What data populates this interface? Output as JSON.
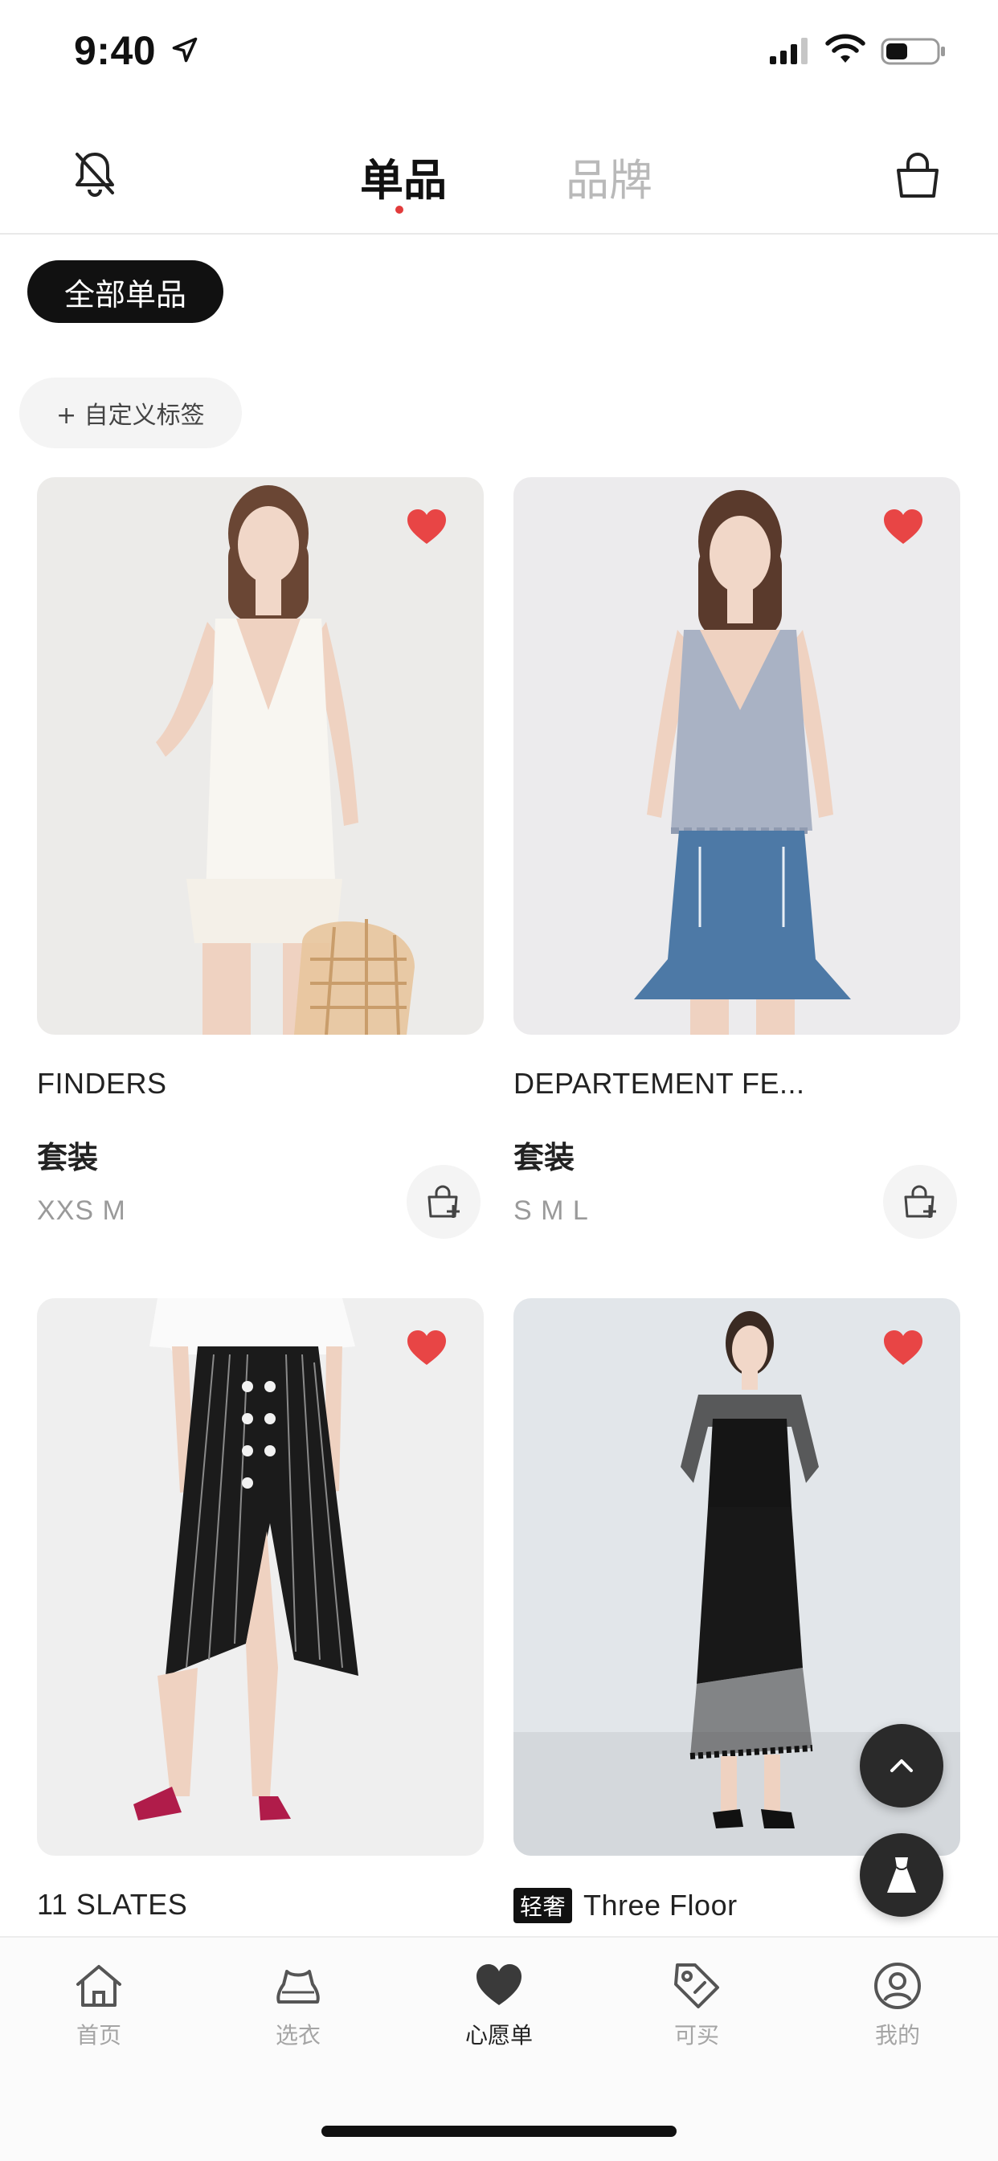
{
  "status_bar": {
    "time": "9:40"
  },
  "nav": {
    "tab_single": "单品",
    "tab_brand": "品牌",
    "active_tab": "单品"
  },
  "filters": {
    "all_items": "全部单品",
    "custom_tag": "+ 自定义标签"
  },
  "products": [
    {
      "brand": "FINDERS",
      "category": "套装",
      "sizes": "XXS M",
      "favorited": true
    },
    {
      "brand": "DEPARTEMENT FE...",
      "category": "套装",
      "sizes": "S M L",
      "favorited": true
    },
    {
      "brand": "11 SLATES",
      "favorited": true
    },
    {
      "tag": "轻奢",
      "brand": "Three Floor",
      "favorited": true
    }
  ],
  "tabbar": {
    "items": [
      {
        "label": "首页",
        "icon": "home-icon"
      },
      {
        "label": "选衣",
        "icon": "dress-icon"
      },
      {
        "label": "心愿单",
        "icon": "heart-icon",
        "active": true
      },
      {
        "label": "可买",
        "icon": "tag-icon"
      },
      {
        "label": "我的",
        "icon": "user-icon"
      }
    ]
  },
  "colors": {
    "accent_red": "#e84545",
    "dark": "#111111",
    "muted": "#a5a5a5"
  }
}
